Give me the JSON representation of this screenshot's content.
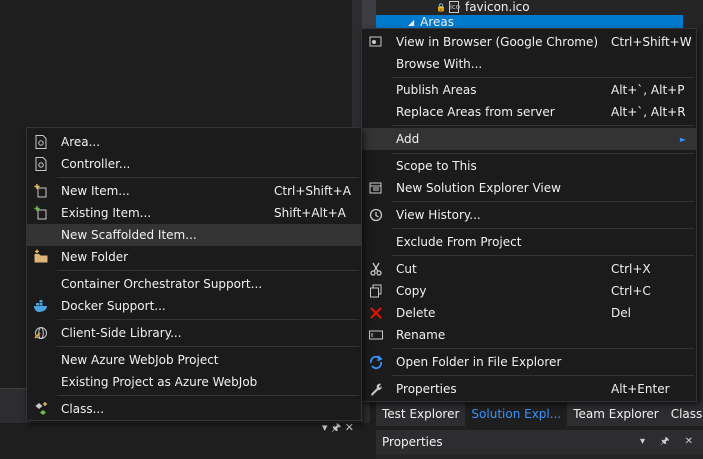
{
  "solution_explorer": {
    "tree": {
      "favicon": "favicon.ico",
      "areas": "Areas"
    },
    "tabs": [
      "Test Explorer",
      "Solution Expl...",
      "Team Explorer",
      "Class View"
    ],
    "properties_title": "Properties",
    "panel_controls": "▾ 🖈 ✕"
  },
  "bottom_panel_controls": "▾ 🖈 ✕",
  "context_menu": {
    "items": [
      {
        "label": "View in Browser (Google Chrome)",
        "shortcut": "Ctrl+Shift+W",
        "icon": "browser-icon"
      },
      {
        "label": "Browse With...",
        "shortcut": "",
        "icon": ""
      },
      {
        "label": "Publish Areas",
        "shortcut": "Alt+`, Alt+P",
        "icon": ""
      },
      {
        "label": "Replace Areas from server",
        "shortcut": "Alt+`, Alt+R",
        "icon": ""
      },
      {
        "label": "Add",
        "shortcut": "",
        "icon": ""
      },
      {
        "label": "Scope to This",
        "shortcut": "",
        "icon": ""
      },
      {
        "label": "New Solution Explorer View",
        "shortcut": "",
        "icon": "new-view-icon"
      },
      {
        "label": "View History...",
        "shortcut": "",
        "icon": "history-icon"
      },
      {
        "label": "Exclude From Project",
        "shortcut": "",
        "icon": ""
      },
      {
        "label": "Cut",
        "shortcut": "Ctrl+X",
        "icon": "cut-icon"
      },
      {
        "label": "Copy",
        "shortcut": "Ctrl+C",
        "icon": "copy-icon"
      },
      {
        "label": "Delete",
        "shortcut": "Del",
        "icon": "delete-icon"
      },
      {
        "label": "Rename",
        "shortcut": "",
        "icon": "rename-icon"
      },
      {
        "label": "Open Folder in File Explorer",
        "shortcut": "",
        "icon": "open-folder-icon"
      },
      {
        "label": "Properties",
        "shortcut": "Alt+Enter",
        "icon": "wrench-icon"
      }
    ]
  },
  "add_submenu": {
    "items": [
      {
        "label": "Area...",
        "shortcut": "",
        "icon": "area-icon"
      },
      {
        "label": "Controller...",
        "shortcut": "",
        "icon": "controller-icon"
      },
      {
        "label": "New Item...",
        "shortcut": "Ctrl+Shift+A",
        "icon": "new-item-icon"
      },
      {
        "label": "Existing Item...",
        "shortcut": "Shift+Alt+A",
        "icon": "existing-item-icon"
      },
      {
        "label": "New Scaffolded Item...",
        "shortcut": "",
        "icon": ""
      },
      {
        "label": "New Folder",
        "shortcut": "",
        "icon": "new-folder-icon"
      },
      {
        "label": "Container Orchestrator Support...",
        "shortcut": "",
        "icon": ""
      },
      {
        "label": "Docker Support...",
        "shortcut": "",
        "icon": "docker-icon"
      },
      {
        "label": "Client-Side Library...",
        "shortcut": "",
        "icon": "client-library-icon"
      },
      {
        "label": "New Azure WebJob Project",
        "shortcut": "",
        "icon": ""
      },
      {
        "label": "Existing Project as Azure WebJob",
        "shortcut": "",
        "icon": ""
      },
      {
        "label": "Class...",
        "shortcut": "",
        "icon": "class-icon"
      }
    ]
  },
  "colors": {
    "accent": "#007acc",
    "link_blue": "#3794ff",
    "menu_bg": "#1b1b1c",
    "highlight": "#333334",
    "delete_red": "#e51400"
  }
}
